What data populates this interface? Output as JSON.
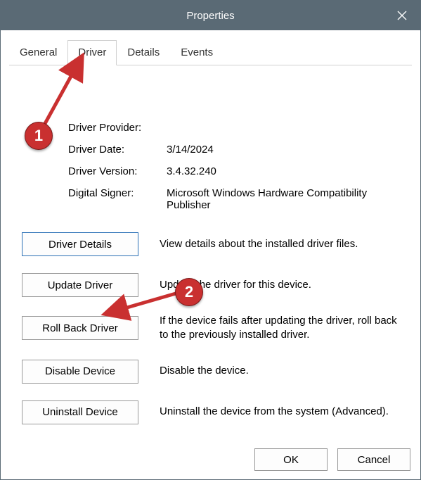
{
  "window": {
    "title": "Properties"
  },
  "tabs": {
    "general": "General",
    "driver": "Driver",
    "details": "Details",
    "events": "Events"
  },
  "driver_info": {
    "provider_label": "Driver Provider:",
    "provider_value": "",
    "date_label": "Driver Date:",
    "date_value": "3/14/2024",
    "version_label": "Driver Version:",
    "version_value": "3.4.32.240",
    "signer_label": "Digital Signer:",
    "signer_value": "Microsoft Windows Hardware Compatibility Publisher"
  },
  "buttons": {
    "details": "Driver Details",
    "details_desc": "View details about the installed driver files.",
    "update": "Update Driver",
    "update_desc": "Update the driver for this device.",
    "rollback": "Roll Back Driver",
    "rollback_desc": "If the device fails after updating the driver, roll back to the previously installed driver.",
    "disable": "Disable Device",
    "disable_desc": "Disable the device.",
    "uninstall": "Uninstall Device",
    "uninstall_desc": "Uninstall the device from the system (Advanced)."
  },
  "footer": {
    "ok": "OK",
    "cancel": "Cancel"
  },
  "annotations": {
    "badge1": "1",
    "badge2": "2"
  }
}
